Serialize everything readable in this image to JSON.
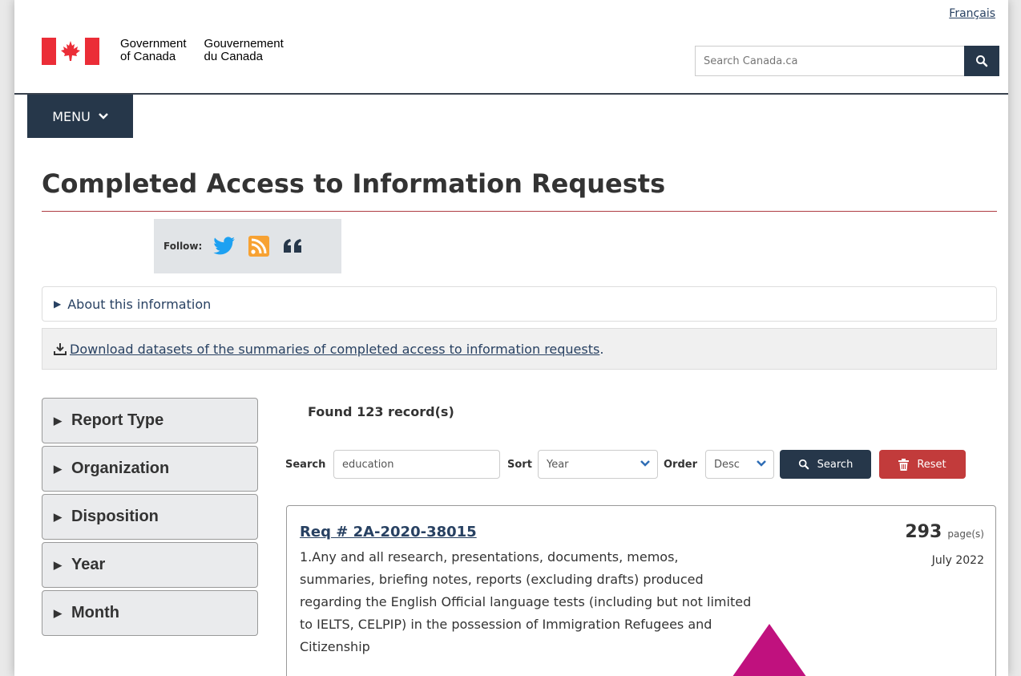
{
  "header": {
    "language_link": "Français",
    "gov_en_line1": "Government",
    "gov_en_line2": "of Canada",
    "gov_fr_line1": "Gouvernement",
    "gov_fr_line2": "du Canada",
    "search_placeholder": "Search Canada.ca",
    "menu_label": "MENU"
  },
  "page": {
    "title": "Completed Access to Information Requests",
    "follow_label": "Follow:",
    "about_label": "About this information",
    "download_link": "Download datasets of the summaries of completed access to information requests",
    "download_suffix": "."
  },
  "facets": [
    {
      "label": "Report Type"
    },
    {
      "label": "Organization"
    },
    {
      "label": "Disposition"
    },
    {
      "label": "Year"
    },
    {
      "label": "Month"
    }
  ],
  "results": {
    "found_text": "Found 123 record(s)",
    "search_label": "Search",
    "search_value": "education",
    "sort_label": "Sort",
    "sort_value": "Year",
    "order_label": "Order",
    "order_value": "Desc",
    "search_button": "Search",
    "reset_button": "Reset"
  },
  "record": {
    "request_id": "Req # 2A-2020-38015",
    "pages_count": "293",
    "pages_unit": "page(s)",
    "date": "July 2022",
    "description": "1.Any and all research, presentations, documents, memos, summaries, briefing notes, reports (excluding drafts) produced regarding the English Official language tests (including but not limited to IELTS, CELPIP) in the possession of Immigration Refugees and Citizenship"
  },
  "colors": {
    "navy": "#26374a",
    "link": "#284162",
    "flag_red": "#eb2d37",
    "reset_red": "#c23b3b",
    "cursor_magenta": "#c0117e"
  }
}
